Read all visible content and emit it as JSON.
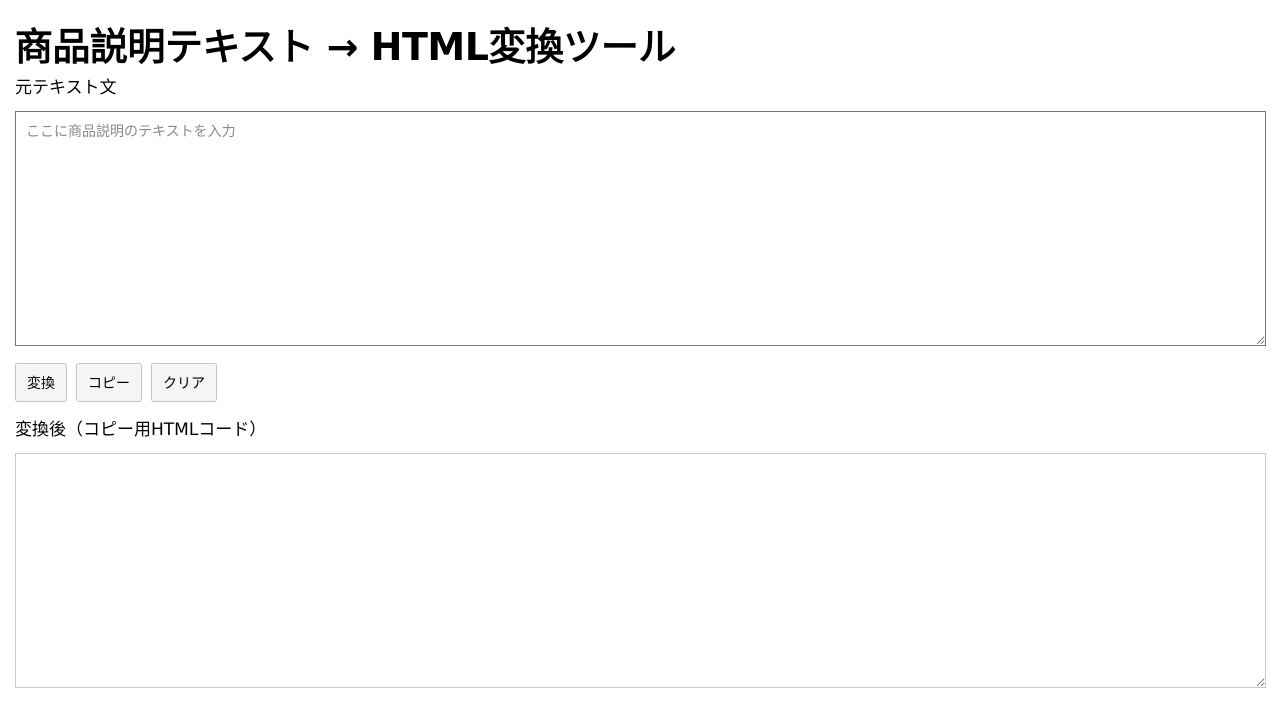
{
  "page": {
    "title": "商品説明テキスト → HTML変換ツール"
  },
  "source": {
    "label": "元テキスト文",
    "value": "",
    "placeholder": "ここに商品説明のテキストを入力"
  },
  "actions": {
    "convert_label": "変換",
    "copy_label": "コピー",
    "clear_label": "クリア"
  },
  "output": {
    "label": "変換後（コピー用HTMLコード）",
    "value": ""
  }
}
